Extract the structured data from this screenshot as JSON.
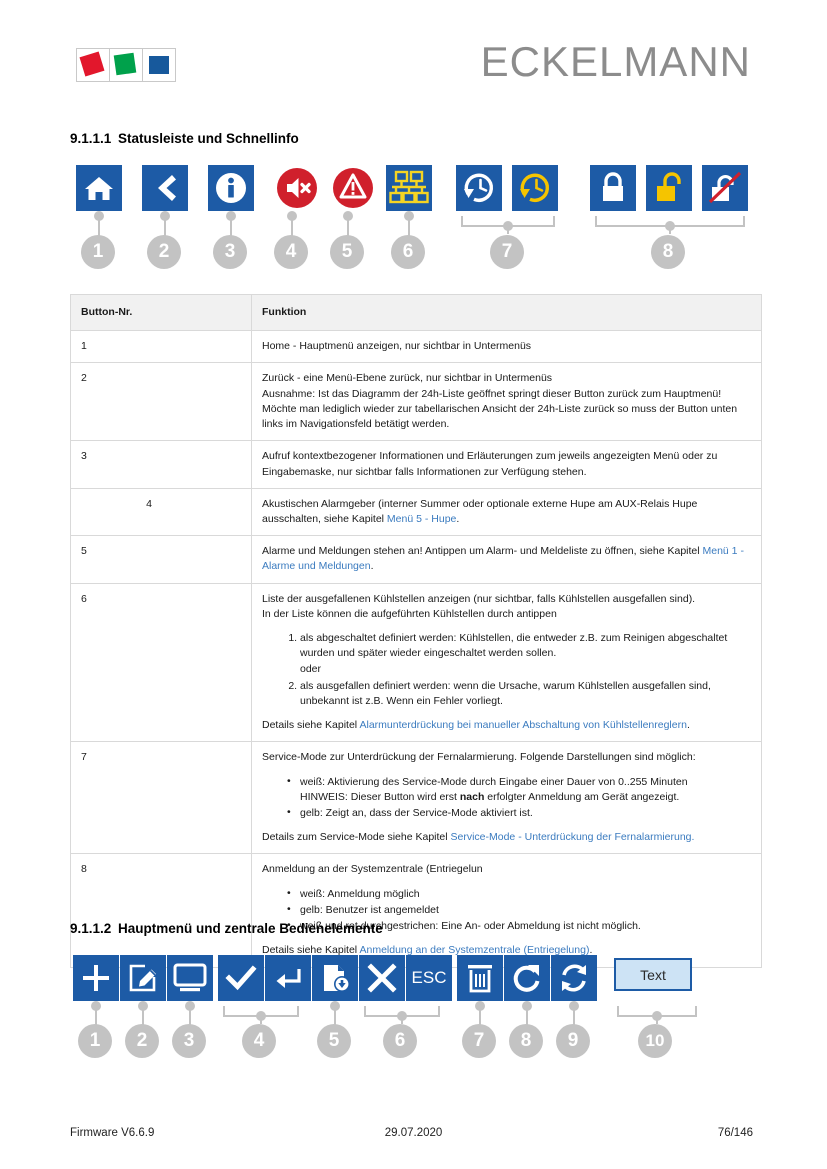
{
  "header": {
    "brand": "ECKELMANN",
    "logo_colors": [
      "#e2172c",
      "#00a14b",
      "#17599c"
    ]
  },
  "sections": [
    {
      "number": "9.1.1.1",
      "title": "Statusleiste und Schnellinfo"
    },
    {
      "number": "9.1.1.2",
      "title": "Hauptmenü und zentrale Bedienelemente"
    }
  ],
  "status_icons": [
    {
      "callout": "1",
      "icon": "home-icon",
      "color": "#1d5ba6"
    },
    {
      "callout": "2",
      "icon": "back-chevron-icon",
      "color": "#1d5ba6"
    },
    {
      "callout": "3",
      "icon": "info-icon",
      "color": "#1d5ba6"
    },
    {
      "callout": "4",
      "icon": "speaker-mute-icon",
      "color": "#d0202c"
    },
    {
      "callout": "5",
      "icon": "warning-triangle-icon",
      "color": "#d0202c"
    },
    {
      "callout": "6",
      "icon": "network-nodes-icon",
      "color": "#1d5ba6"
    },
    {
      "callout": "7",
      "icon": "service-mode-clock-white-icon",
      "color": "#1d5ba6"
    },
    {
      "callout": "7",
      "icon": "service-mode-clock-yellow-icon",
      "color": "#1d5ba6"
    },
    {
      "callout": "8",
      "icon": "lock-closed-white-icon",
      "color": "#1d5ba6"
    },
    {
      "callout": "8",
      "icon": "lock-open-yellow-icon",
      "color": "#1d5ba6"
    },
    {
      "callout": "8",
      "icon": "lock-crossed-out-icon",
      "color": "#1d5ba6"
    }
  ],
  "table": {
    "headers": [
      "Button-Nr.",
      "Funktion"
    ],
    "rows": [
      {
        "nr": "1",
        "lines": [
          "Home - Hauptmenü anzeigen, nur sichtbar in Untermenüs"
        ]
      },
      {
        "nr": "2",
        "lines": [
          "Zurück - eine Menü-Ebene zurück, nur sichtbar in Untermenüs",
          "Ausnahme: Ist das Diagramm der 24h-Liste geöffnet springt dieser Button zurück zum Hauptmenü!",
          "Möchte man lediglich wieder zur tabellarischen Ansicht der 24h-Liste zurück so muss der Button unten links im Navigationsfeld betätigt werden."
        ]
      },
      {
        "nr": "3",
        "lines": [
          "Aufruf kontextbezogener Informationen und Erläuterungen zum jeweils angezeigten Menü oder zu Eingabemaske, nur sichtbar falls Informationen zur Verfügung stehen."
        ]
      },
      {
        "nr": "4",
        "centered_nr": true,
        "text_before": "Akustischen Alarmgeber (interner Summer oder optionale externe Hupe am AUX-Relais Hupe ausschalten, siehe Kapitel ",
        "link": "Menü 5 - Hupe",
        "text_after": "."
      },
      {
        "nr": "5",
        "text_before": "Alarme und Meldungen stehen an! Antippen um Alarm- und Meldeliste zu öffnen, siehe Kapitel ",
        "link": "Menü 1 - Alarme und Meldungen",
        "text_after": "."
      },
      {
        "nr": "6",
        "lines": [
          "Liste der ausgefallenen Kühlstellen anzeigen (nur sichtbar, falls Kühlstellen ausgefallen sind).",
          "In der Liste können die aufgeführten Kühlstellen durch antippen"
        ],
        "ordered": [
          "als abgeschaltet definiert werden: Kühlstellen, die entweder z.B. zum Reinigen abgeschaltet wurden und später wieder eingeschaltet werden sollen.",
          "oder",
          "als ausgefallen definiert werden: wenn die Ursache, warum Kühlstellen ausgefallen sind, unbekannt ist z.B. Wenn ein Fehler vorliegt."
        ],
        "details_prefix": "Details siehe Kapitel ",
        "details_link": "Alarmunterdrückung bei manueller Abschaltung von Kühlstellenreglern",
        "details_suffix": "."
      },
      {
        "nr": "7",
        "lines": [
          "Service-Mode zur Unterdrückung der Fernalarmierung. Folgende Darstellungen sind möglich:"
        ],
        "bullets": [
          "weiß: Aktivierung des Service-Mode durch Eingabe einer Dauer von 0..255 Minuten",
          "gelb: Zeigt an, dass der Service-Mode aktiviert ist."
        ],
        "note_prefix": "HINWEIS: Dieser Button wird erst ",
        "note_bold": "nach",
        "note_suffix": " erfolgter Anmeldung am Gerät angezeigt.",
        "details_prefix": "Details zum Service-Mode siehe Kapitel ",
        "details_link": "Service-Mode - Unterdrückung der Fernalarmierung.",
        "details_suffix": ""
      },
      {
        "nr": "8",
        "lines": [
          "Anmeldung an der Systemzentrale (Entriegelun"
        ],
        "bullets": [
          "weiß: Anmeldung möglich",
          "gelb: Benutzer ist angemeldet",
          "weiß und rot durchgestrichen: Eine An- oder Abmeldung ist nicht möglich."
        ],
        "details_prefix": "Details siehe Kapitel ",
        "details_link": "Anmeldung an der Systemzentrale (Entriegelung)",
        "details_suffix": "."
      }
    ]
  },
  "menu_icons": [
    {
      "callout": "1",
      "icon": "plus-icon"
    },
    {
      "callout": "2",
      "icon": "edit-pencil-icon"
    },
    {
      "callout": "3",
      "icon": "monitor-icon"
    },
    {
      "callout": "4",
      "icon": "check-icon"
    },
    {
      "callout": "4",
      "icon": "enter-arrow-icon"
    },
    {
      "callout": "5",
      "icon": "save-document-icon"
    },
    {
      "callout": "6",
      "icon": "close-x-icon"
    },
    {
      "callout": "6",
      "icon": "esc-icon",
      "label": "ESC"
    },
    {
      "callout": "7",
      "icon": "trash-icon"
    },
    {
      "callout": "8",
      "icon": "refresh-single-icon"
    },
    {
      "callout": "9",
      "icon": "refresh-cycle-icon"
    },
    {
      "callout": "10",
      "icon": "text-input-button",
      "label": "Text"
    }
  ],
  "footer": {
    "left": "Firmware V6.6.9",
    "center": "29.07.2020",
    "right": "76/146"
  }
}
